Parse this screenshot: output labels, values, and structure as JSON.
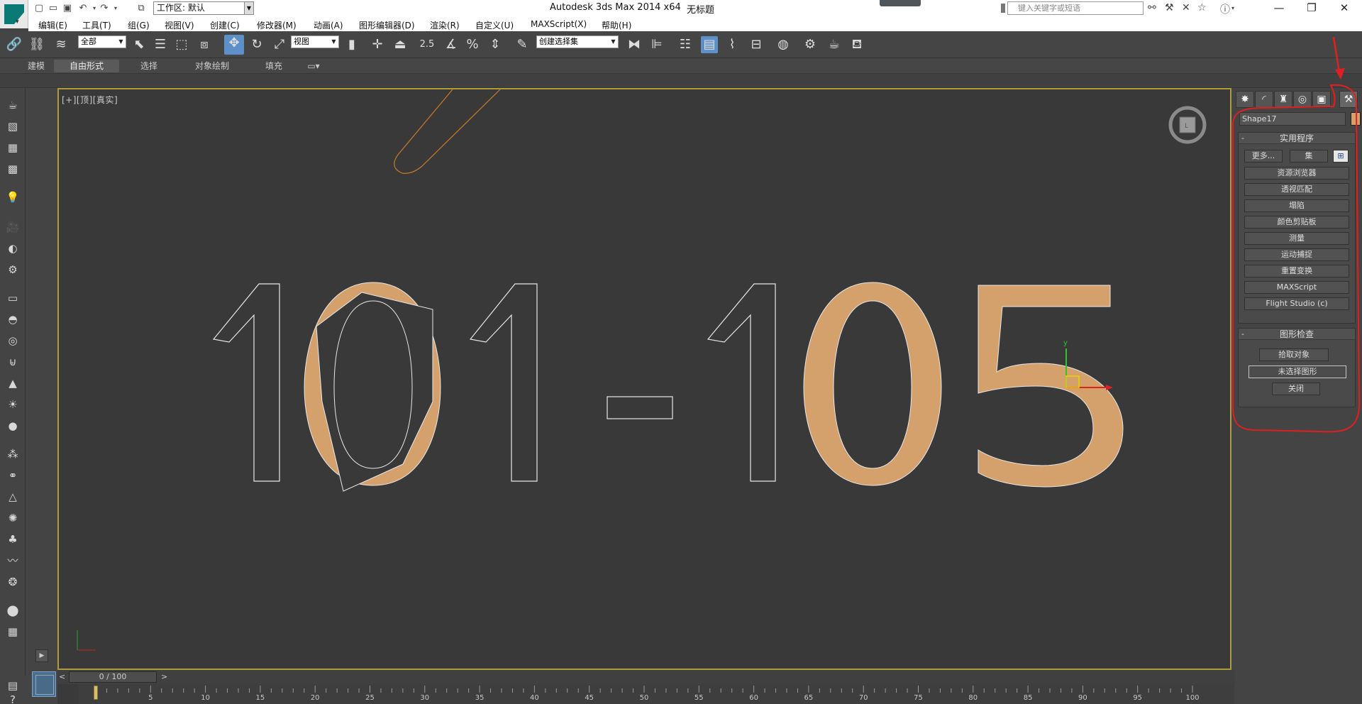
{
  "title_bar": {
    "workspace_label": "工作区: 默认",
    "app_title": "Autodesk 3ds Max  2014 x64",
    "file_title": "无标题",
    "search_placeholder": "键入关键字或短语"
  },
  "menu": {
    "items": [
      "编辑(E)",
      "工具(T)",
      "组(G)",
      "视图(V)",
      "创建(C)",
      "修改器(M)",
      "动画(A)",
      "图形编辑器(D)",
      "渲染(R)",
      "自定义(U)",
      "MAXScript(X)",
      "帮助(H)"
    ]
  },
  "toolbar": {
    "selection_filter": "全部",
    "coordinate_system": "视图",
    "snap_angle": "2.5",
    "named_selection_set": "创建选择集"
  },
  "ribbon": {
    "tabs": [
      "建模",
      "自由形式",
      "选择",
      "对象绘制",
      "填充"
    ],
    "active_tab": "自由形式"
  },
  "viewport": {
    "label_plus": "[+]",
    "label_view": "[顶]",
    "label_shading": "[真实]",
    "scene_text": "101-105",
    "axis_y": "y"
  },
  "command_panel": {
    "object_name": "Shape17",
    "object_color": "#d4a06c",
    "utilities_title": "实用程序",
    "more_button": "更多...",
    "sets_button": "集",
    "utility_buttons": [
      "资源浏览器",
      "透视匹配",
      "塌陷",
      "颜色剪贴板",
      "测量",
      "运动捕捉",
      "重置变换",
      "MAXScript",
      "Flight Studio (c)"
    ],
    "shape_check_title": "图形检查",
    "pick_object_button": "拾取对象",
    "no_shape_selected_button": "未选择图形",
    "close_button": "关闭"
  },
  "timeline": {
    "frame_display": "0 / 100",
    "ticks": [
      "5",
      "10",
      "15",
      "20",
      "25",
      "30",
      "35",
      "40",
      "45",
      "50",
      "55",
      "60",
      "65",
      "70",
      "75",
      "80",
      "85",
      "90",
      "95",
      "100"
    ]
  },
  "colors": {
    "shape_fill": "#d4a06c",
    "viewport_border": "#b09b3a",
    "annotation_red": "#e02020"
  }
}
